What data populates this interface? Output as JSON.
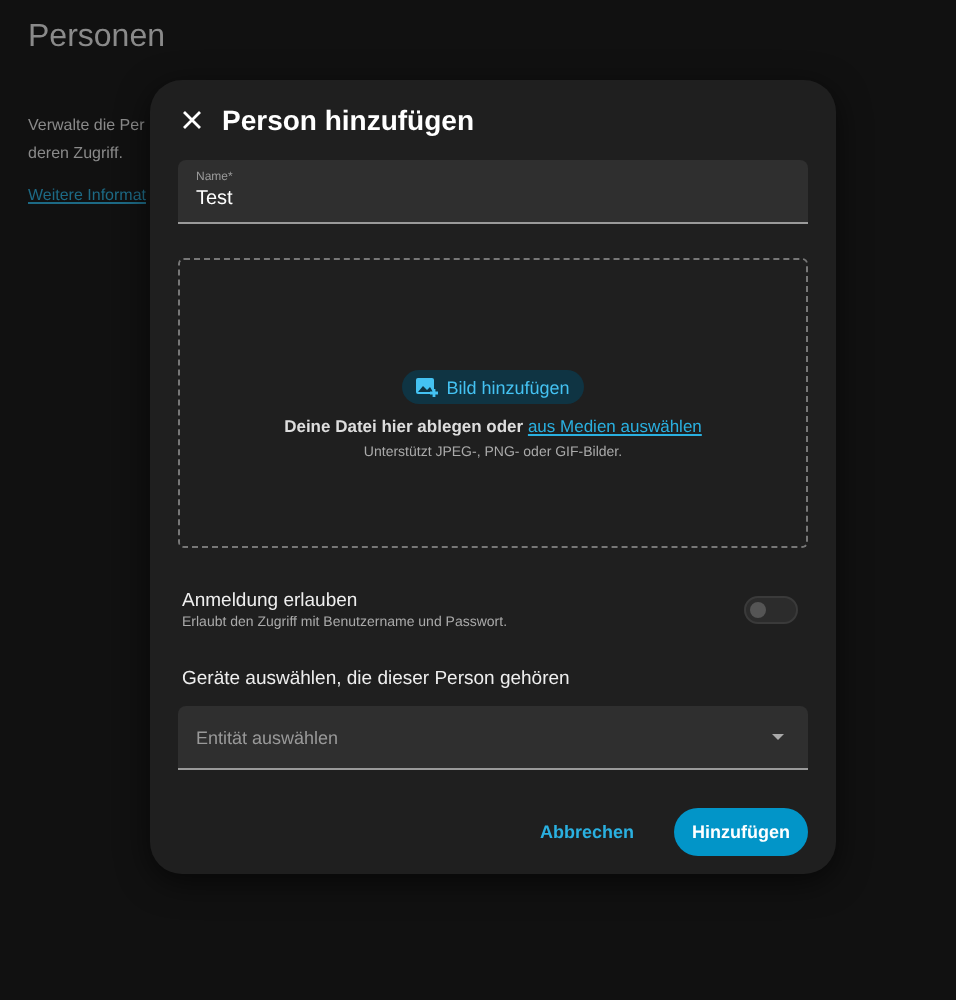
{
  "page": {
    "title": "Personen",
    "description_lines": [
      "Verwalte die Per",
      "deren Zugriff."
    ],
    "link": "Weitere Informat"
  },
  "dialog": {
    "title": "Person hinzufügen",
    "name_field": {
      "label": "Name*",
      "value": "Test"
    },
    "dropzone": {
      "button": "Bild hinzufügen",
      "text": "Deine Datei hier ablegen oder ",
      "link": "aus Medien auswählen",
      "hint": "Unterstützt JPEG-, PNG- oder GIF-Bilder."
    },
    "login": {
      "title": "Anmeldung erlauben",
      "subtitle": "Erlaubt den Zugriff mit Benutzername und Passwort.",
      "on": false
    },
    "devices": {
      "heading": "Geräte auswählen, die dieser Person gehören",
      "placeholder": "Entität auswählen"
    },
    "buttons": [
      {
        "label": "Abbrechen",
        "kind": "text"
      },
      {
        "label": "Hinzufügen",
        "kind": "filled"
      }
    ]
  }
}
